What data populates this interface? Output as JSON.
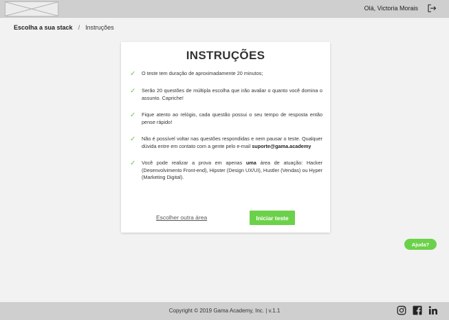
{
  "header": {
    "greeting": "Olá, Victoria Morais",
    "logout_icon": "logout-icon",
    "logo_icon": "logo-placeholder"
  },
  "breadcrumb": {
    "root": "Escolha a sua stack",
    "separator": "/",
    "current": "Instruções"
  },
  "card": {
    "title": "INSTRUÇÕES",
    "items": [
      {
        "text": "O teste tem duração de aproximadamente 20 minutos;"
      },
      {
        "text": "Serão 20 questões de múltipla escolha que irão avaliar o quanto você domina o assunto. Capriche!"
      },
      {
        "text": "Fique atento ao relógio, cada questão possui o seu tempo de resposta então pense rápido!"
      },
      {
        "text_before": "Não é possível voltar nas questões respondidas e nem pausar o teste. Qualquer dúvida entre em contato com a gente pelo e-mail ",
        "email": "suporte@gama.academy"
      },
      {
        "text_before": "Você pode realizar a prova em apenas ",
        "bold": "uma",
        "text_after": " área de atuação: Hacker (Desenvolvimento Front-end), Hipster (Design UX/UI), Hustler (Vendas) ou Hyper (Marketing Digital)."
      }
    ],
    "alt_link": "Escolher outra área",
    "start_button": "Iniciar teste"
  },
  "help_button": "Ajuda?",
  "footer": {
    "copyright": "Copyright © 2019 Gama Academy, Inc. | v.1.1",
    "social_icons": [
      "instagram-icon",
      "facebook-icon",
      "linkedin-icon"
    ]
  },
  "colors": {
    "accent_green": "#6cd14a",
    "check_green": "#6cc644",
    "bar_gray": "#cfcfcf",
    "background": "#f2f2f2"
  }
}
